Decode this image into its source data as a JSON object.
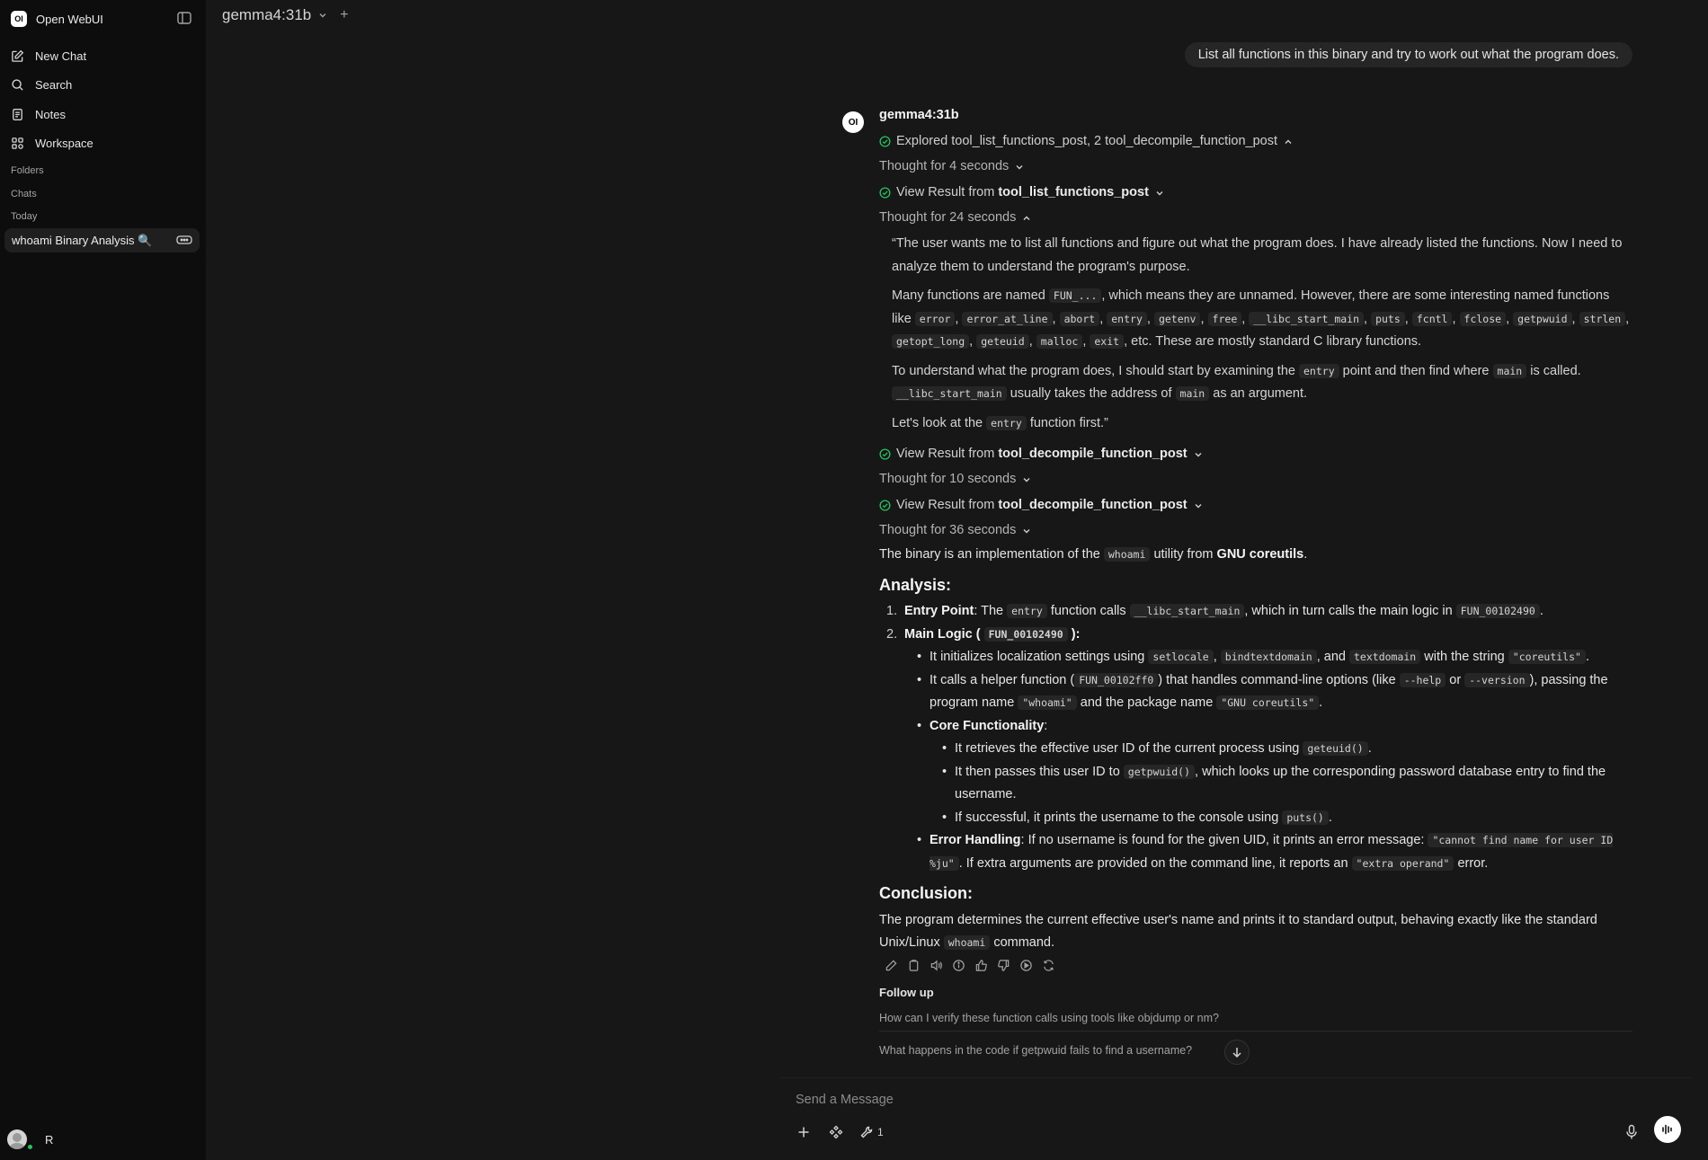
{
  "sidebar": {
    "app_name": "Open WebUI",
    "logo": "OI",
    "nav": [
      "New Chat",
      "Search",
      "Notes",
      "Workspace"
    ],
    "folders_label": "Folders",
    "chats_label": "Chats",
    "today_label": "Today",
    "active_chat": "whoami Binary Analysis 🔍",
    "user_initial": "R"
  },
  "topbar": {
    "model": "gemma4:31b",
    "plus": "+"
  },
  "user_message": "List all functions in this binary and try to work out what the program does.",
  "assistant": {
    "avatar": "OI",
    "model": "gemma4:31b",
    "explored": "Explored tool_list_functions_post, 2 tool_decompile_function_post",
    "thought1": "Thought for 4 seconds",
    "view_prefix": "View Result from",
    "result1": "tool_list_functions_post",
    "thought2": "Thought for 24 seconds",
    "thought2_content": {
      "p1": "“The user wants me to list all functions and figure out what the program does. I have already listed the functions. Now I need to analyze them to understand the program's purpose.",
      "p2_pre": "Many functions are named",
      "p2_code1": "FUN_...",
      "p2_mid": ", which means they are unnamed. However, there are some interesting named functions like",
      "p2_codes": [
        "error",
        "error_at_line",
        "abort",
        "entry",
        "getenv",
        "free",
        "__libc_start_main",
        "puts",
        "fcntl",
        "fclose",
        "getpwuid",
        "strlen",
        "getopt_long",
        "geteuid",
        "malloc",
        "exit"
      ],
      "p2_post": ", etc. These are mostly standard C library functions.",
      "p3_a": "To understand what the program does, I should start by examining the",
      "p3_c1": "entry",
      "p3_b": "point and then find where",
      "p3_c2": "main",
      "p3_c": "is called.",
      "p3_c3": "__libc_start_main",
      "p3_d": "usually takes the address of",
      "p3_c4": "main",
      "p3_e": "as an argument.",
      "p4_a": "Let's look at the",
      "p4_c": "entry",
      "p4_b": "function first.”"
    },
    "result2": "tool_decompile_function_post",
    "thought3": "Thought for 10 seconds",
    "result3": "tool_decompile_function_post",
    "thought4": "Thought for 36 seconds",
    "intro_a": "The binary is an implementation of the",
    "intro_code": "whoami",
    "intro_b": "utility from",
    "intro_bold": "GNU coreutils",
    "intro_c": ".",
    "analysis_heading": "Analysis:",
    "item1": {
      "num": "1.",
      "title": "Entry Point",
      "a": ": The",
      "c1": "entry",
      "b": "function calls",
      "c2": "__libc_start_main",
      "c": ", which in turn calls the main logic in",
      "c3": "FUN_00102490",
      "d": "."
    },
    "item2": {
      "num": "2.",
      "title_a": "Main Logic (",
      "title_code": "FUN_00102490",
      "title_b": "):",
      "b1": {
        "a": "It initializes localization settings using",
        "c1": "setlocale",
        "s1": ",",
        "c2": "bindtextdomain",
        "s2": ", and",
        "c3": "textdomain",
        "b": "with the string",
        "c4": "\"coreutils\"",
        "e": "."
      },
      "b2": {
        "a": "It calls a helper function (",
        "c1": "FUN_00102ff0",
        "b": ") that handles command-line options (like",
        "c2": "--help",
        "or": "or",
        "c3": "--version",
        "c": "), passing the program name",
        "c4": "\"whoami\"",
        "d": "and the package name",
        "c5": "\"GNU coreutils\"",
        "e": "."
      },
      "b3_title": "Core Functionality",
      "b3_colon": ":",
      "sub1": {
        "a": "It retrieves the effective user ID of the current process using",
        "c": "geteuid()",
        "b": "."
      },
      "sub2": {
        "a": "It then passes this user ID to",
        "c": "getpwuid()",
        "b": ", which looks up the corresponding password database entry to find the username."
      },
      "sub3": {
        "a": "If successful, it prints the username to the console using",
        "c": "puts()",
        "b": "."
      },
      "b4_title": "Error Handling",
      "b4": {
        "a": ": If no username is found for the given UID, it prints an error message:",
        "c1": "\"cannot find name for user ID %ju\"",
        "b": ". If extra arguments are provided on the command line, it reports an",
        "c2": "\"extra operand\"",
        "c": "error."
      }
    },
    "conclusion_heading": "Conclusion:",
    "conclusion_a": "The program determines the current effective user's name and prints it to standard output, behaving exactly like the standard Unix/Linux",
    "conclusion_code": "whoami",
    "conclusion_b": "command."
  },
  "followup": {
    "title": "Follow up",
    "items": [
      "How can I verify these function calls using tools like objdump or nm?",
      "What happens in the code if getpwuid fails to find a username?"
    ]
  },
  "composer": {
    "placeholder": "Send a Message",
    "tool_count": "1"
  },
  "colors": {
    "background": "#171717",
    "sidebar": "#0d0d0d",
    "check": "#22c55e",
    "code_bg": "#262626"
  }
}
